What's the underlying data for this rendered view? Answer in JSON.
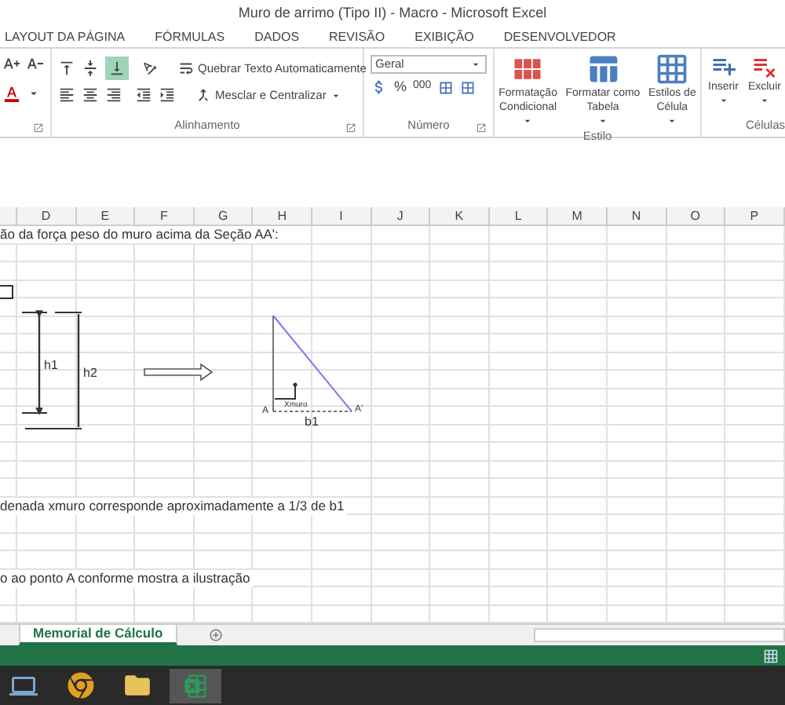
{
  "window": {
    "title": "Muro de arrimo (Tipo II) - Macro - Microsoft Excel"
  },
  "ribbon_tabs": [
    "LAYOUT DA PÁGINA",
    "FÓRMULAS",
    "DADOS",
    "REVISÃO",
    "EXIBIÇÃO",
    "DESENVOLVEDOR"
  ],
  "alignment_group": {
    "label": "Alinhamento",
    "wrap_text": "Quebrar Texto Automaticamente",
    "merge_center": "Mesclar e Centralizar",
    "bottom_align_selected": true
  },
  "number_group": {
    "label": "Número",
    "format": "Geral",
    "percent": "%",
    "thousands": "000"
  },
  "styles_group": {
    "label": "Estilo",
    "buttons": [
      {
        "line1": "Formatação",
        "line2": "Condicional",
        "kind": "conditional"
      },
      {
        "line1": "Formatar como",
        "line2": "Tabela",
        "kind": "table"
      },
      {
        "line1": "Estilos de",
        "line2": "Célula",
        "kind": "cell"
      }
    ]
  },
  "cells_group": {
    "label": "Células",
    "buttons": [
      {
        "label": "Inserir",
        "kind": "insert"
      },
      {
        "label": "Excluir",
        "kind": "delete"
      }
    ]
  },
  "columns": [
    "D",
    "E",
    "F",
    "G",
    "H",
    "I",
    "J",
    "K",
    "L",
    "M",
    "N",
    "O",
    "P"
  ],
  "cells": [
    "ão da força peso do muro acima da Seção AA':",
    "denada xmuro corresponde aproximadamente a 1/3 de b1",
    "o ao ponto A conforme mostra a ilustração"
  ],
  "diagram": {
    "h1": "h1",
    "h2": "h2",
    "xmuro": "Xmuro",
    "point_a": "A",
    "point_a2": "A'",
    "b1": "b1"
  },
  "sheet_tabs": [
    {
      "label": "Memorial de Cálculo",
      "selected": true
    }
  ]
}
